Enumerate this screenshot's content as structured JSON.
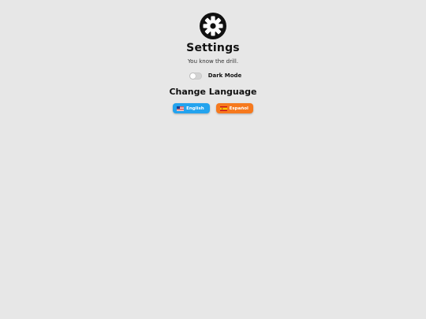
{
  "settings": {
    "title": "Settings",
    "subtitle": "You know the drill.",
    "dark_mode": {
      "label": "Dark Mode",
      "enabled": false
    },
    "language": {
      "title": "Change Language",
      "options": [
        {
          "label": "English",
          "icon": "us-flag-icon",
          "color": "#23a3ee"
        },
        {
          "label": "Español",
          "icon": "spain-flag-icon",
          "color": "#f6791e"
        }
      ]
    }
  },
  "icons": {
    "header": "gear-icon"
  },
  "colors": {
    "background": "#e7e7e7",
    "text": "#111111"
  }
}
